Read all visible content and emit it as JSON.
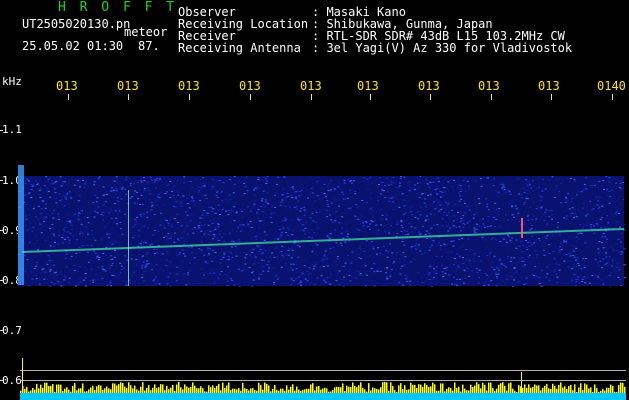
{
  "header": {
    "logo": "H R O F F T",
    "filename": "UT2505020130.pn",
    "filename_suffix": "meteor",
    "datetime": "25.05.02 01:30",
    "count": "87.",
    "info_labels": [
      "Observer",
      "Receiving Location",
      "Receiver",
      "Receiving Antenna"
    ],
    "info_values": [
      ": Masaki Kano",
      ": Shibukawa, Gunma, Japan",
      ": RTL-SDR SDR# 43dB L15 103.2MHz CW",
      ": 3el Yagi(V) Az 330 for Vladivostok"
    ]
  },
  "axes": {
    "y_unit": "kHz",
    "y_ticks": [
      "1.1",
      "1.0",
      "0.9",
      "0.8",
      "0.7",
      "0.6"
    ],
    "x_ticks": [
      "013",
      "013",
      "013",
      "013",
      "013",
      "013",
      "013",
      "013",
      "013",
      "0140"
    ]
  },
  "colors": {
    "background": "#000000",
    "header_green": "#22d022",
    "time_labels": "#ffe600",
    "band": "#1a2fd0",
    "trail": "#40e0a0",
    "bottom_bars": "#ffff00",
    "bottom_base": "#00c8ff"
  }
}
